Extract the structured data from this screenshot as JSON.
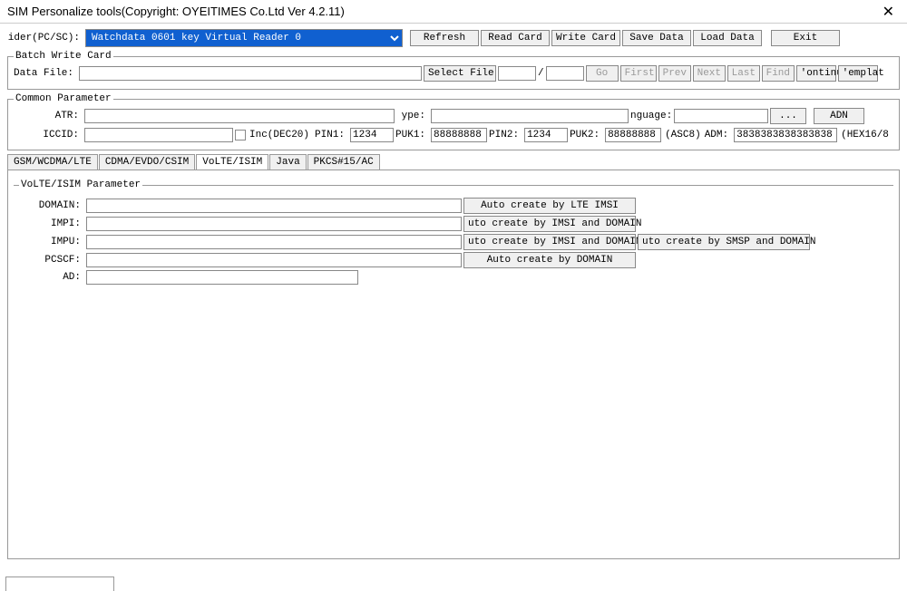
{
  "window": {
    "title": "SIM Personalize tools(Copyright: OYEITIMES Co.Ltd  Ver 4.2.11)"
  },
  "reader": {
    "label": "ider(PC/SC):",
    "selected": "Watchdata 0601 key Virtual Reader 0"
  },
  "toolbar": {
    "refresh": "Refresh",
    "read_card": "Read Card",
    "write_card": "Write Card",
    "save_data": "Save Data",
    "load_data": "Load Data",
    "exit": "Exit"
  },
  "batch": {
    "legend": "Batch Write Card",
    "datafile_label": "Data File:",
    "datafile": "",
    "select_file": "Select File",
    "idx1": "",
    "slash": "/",
    "idx2": "",
    "go": "Go",
    "first": "First",
    "prev": "Prev",
    "next": "Next",
    "last": "Last",
    "find": "Find",
    "continue": "'ontinu",
    "template": "'emplat"
  },
  "common": {
    "legend": "Common Parameter",
    "atr_label": "ATR:",
    "atr": "",
    "type_label": "ype:",
    "type": "",
    "lang_label": "nguage:",
    "lang": "",
    "lang_btn": "...",
    "adn": "ADN",
    "iccid_label": "ICCID:",
    "iccid": "",
    "inc_label": "Inc(DEC20)",
    "pin1_label": "PIN1:",
    "pin1": "1234",
    "puk1_label": "PUK1:",
    "puk1": "88888888",
    "pin2_label": "PIN2:",
    "pin2": "1234",
    "puk2_label": "PUK2:",
    "puk2": "88888888",
    "asc8": "(ASC8)",
    "adm_label": "ADM:",
    "adm": "3838383838383838",
    "hex": "(HEX16/8"
  },
  "tabs": {
    "t1": "GSM/WCDMA/LTE",
    "t2": "CDMA/EVDO/CSIM",
    "t3": "VoLTE/ISIM",
    "t4": "Java",
    "t5": "PKCS#15/AC"
  },
  "volte": {
    "legend": "VoLTE/ISIM  Parameter",
    "domain_label": "DOMAIN:",
    "domain": "",
    "domain_btn": "Auto create by LTE IMSI",
    "impi_label": "IMPI:",
    "impi": "",
    "impi_btn": "uto create by IMSI and DOMAIN",
    "impu_label": "IMPU:",
    "impu": "",
    "impu_btn1": "uto create by IMSI and DOMAIN",
    "impu_btn2": "uto create by SMSP and DOMAIN",
    "pcscf_label": "PCSCF:",
    "pcscf": "",
    "pcscf_btn": "Auto create by DOMAIN",
    "ad_label": "AD:",
    "ad": ""
  }
}
